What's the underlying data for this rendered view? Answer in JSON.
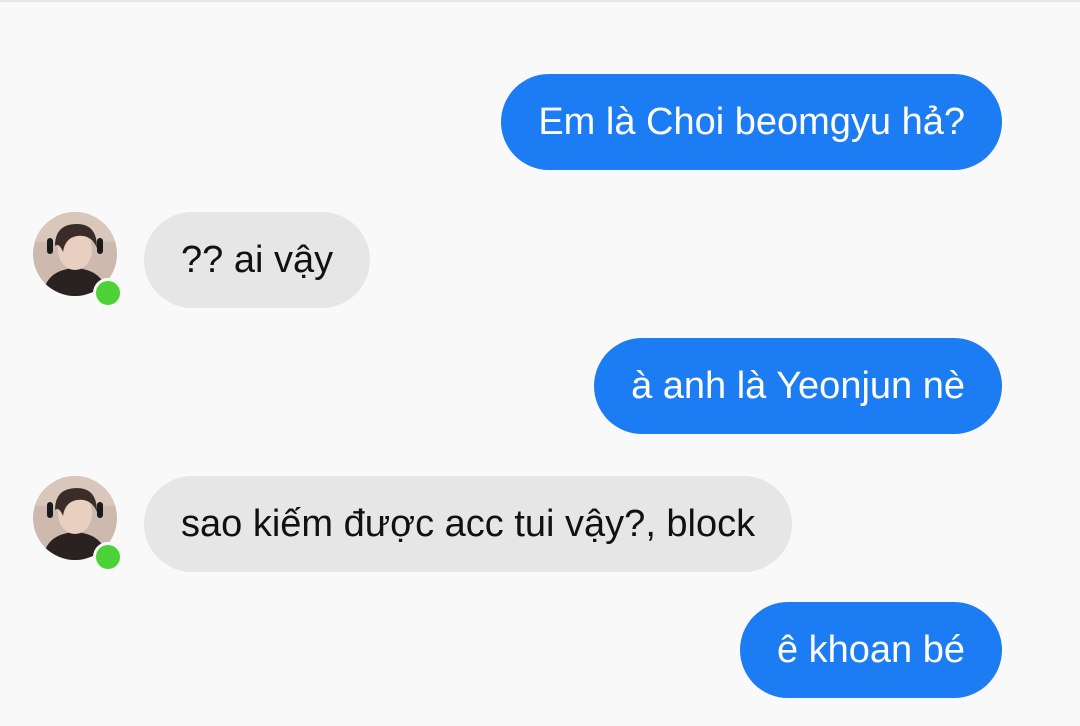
{
  "colors": {
    "sent_bubble": "#1b7cf3",
    "received_bubble": "#e6e6e6",
    "online": "#4cd137",
    "background": "#f9f9f9"
  },
  "messages": [
    {
      "direction": "sent",
      "text": "Em là Choi beomgyu hả?"
    },
    {
      "direction": "received",
      "text": "?? ai vậy"
    },
    {
      "direction": "sent",
      "text": "à anh là Yeonjun nè"
    },
    {
      "direction": "received",
      "text": "sao kiếm được acc tui vậy?, block"
    },
    {
      "direction": "sent",
      "text": "ê khoan bé"
    }
  ]
}
